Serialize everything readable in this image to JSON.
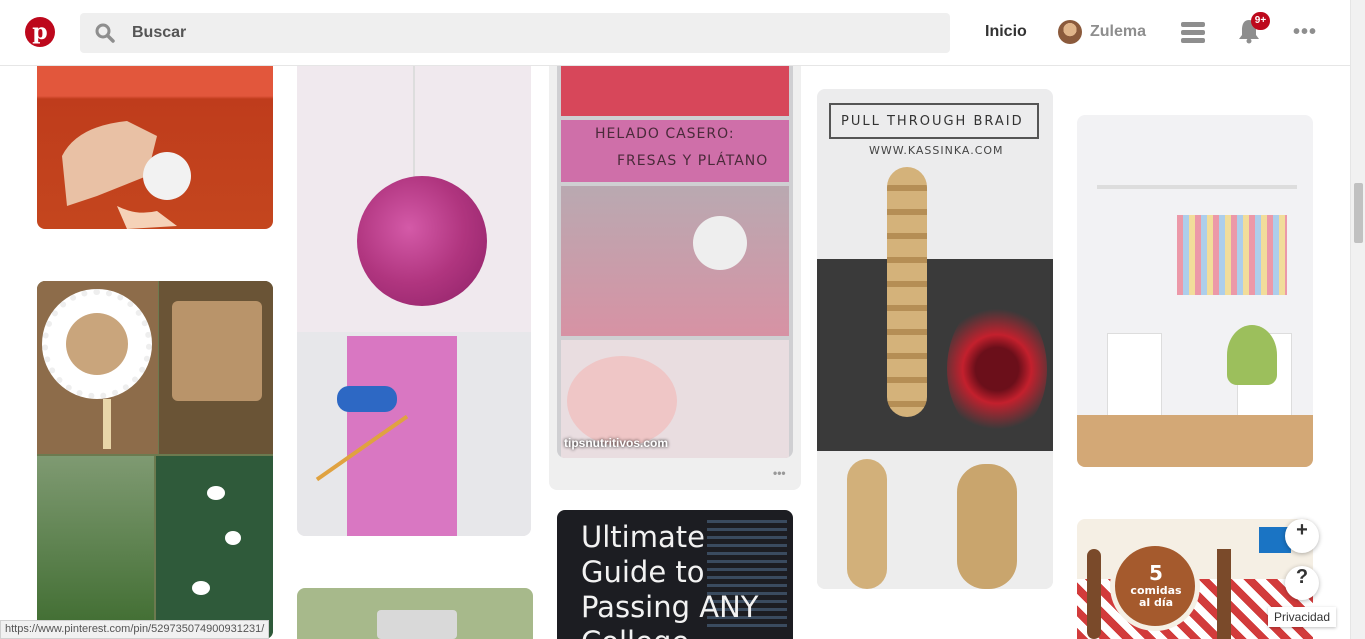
{
  "header": {
    "logo_letter": "p",
    "search_placeholder": "Buscar",
    "nav_home": "Inicio",
    "user_name": "Zulema",
    "notifications_badge": "9+",
    "more_glyph": "•••"
  },
  "pins": {
    "smoothie_source": "tipsnutritivos.com",
    "helado_line1": "HELADO CASERO:",
    "helado_line2": "FRESAS Y PLÁTANO",
    "braid_title": "PULL THROUGH BRAID",
    "braid_site": "WWW.KASSINKA.COM",
    "guide_text": "Ultimate Guide to Passing ANY College",
    "comidas_number": "5",
    "comidas_text": "comidas al día",
    "dots": "•••"
  },
  "controls": {
    "add_button": "+",
    "help_button": "?",
    "privacy": "Privacidad"
  },
  "status_bar": {
    "url": "https://www.pinterest.com/pin/529735074900931231/"
  }
}
